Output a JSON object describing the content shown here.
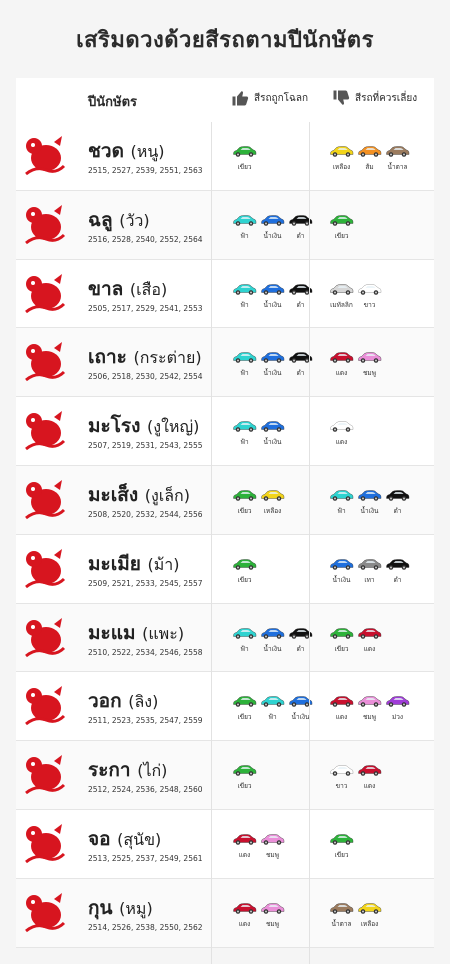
{
  "title": "เสริมดวงด้วยสีรถตามปีนักษัตร",
  "header": {
    "col_zodiac": "ปีนักษัตร",
    "col_good": "สีรถถูกโฉลก",
    "col_bad": "สีรถที่ควรเลี่ยง"
  },
  "icons": {
    "good": "thumbs-up-icon",
    "bad": "thumbs-down-icon"
  },
  "rows": [
    {
      "name": "ชวด",
      "sub": "(หนู)",
      "years": "2515, 2527, 2539, 2551, 2563",
      "good": [
        {
          "color": "#2db23a",
          "label": "เขียว"
        }
      ],
      "bad": [
        {
          "color": "#f2d41a",
          "label": "เหลือง"
        },
        {
          "color": "#f29022",
          "label": "ส้ม"
        },
        {
          "color": "#9b7b5e",
          "label": "น้ำตาล"
        }
      ]
    },
    {
      "name": "ฉลู",
      "sub": "(วัว)",
      "years": "2516, 2528, 2540, 2552, 2564",
      "good": [
        {
          "color": "#2ed3d0",
          "label": "ฟ้า"
        },
        {
          "color": "#1f6fdd",
          "label": "น้ำเงิน"
        },
        {
          "color": "#111111",
          "label": "ดำ"
        }
      ],
      "bad": [
        {
          "color": "#2db23a",
          "label": "เขียว"
        }
      ]
    },
    {
      "name": "ขาล",
      "sub": "(เสือ)",
      "years": "2505, 2517, 2529, 2541, 2553",
      "good": [
        {
          "color": "#2ed3d0",
          "label": "ฟ้า"
        },
        {
          "color": "#1f6fdd",
          "label": "น้ำเงิน"
        },
        {
          "color": "#111111",
          "label": "ดำ"
        }
      ],
      "bad": [
        {
          "color": "#d7d7d7",
          "label": "เมทัลลิก"
        },
        {
          "color": "#ffffff",
          "label": "ขาว"
        }
      ]
    },
    {
      "name": "เถาะ",
      "sub": "(กระต่าย)",
      "years": "2506, 2518, 2530, 2542, 2554",
      "good": [
        {
          "color": "#2ed3d0",
          "label": "ฟ้า"
        },
        {
          "color": "#1f6fdd",
          "label": "น้ำเงิน"
        },
        {
          "color": "#111111",
          "label": "ดำ"
        }
      ],
      "bad": [
        {
          "color": "#c8102e",
          "label": "แดง"
        },
        {
          "color": "#ea8fd8",
          "label": "ชมพู"
        }
      ]
    },
    {
      "name": "มะโรง",
      "sub": "(งูใหญ่)",
      "years": "2507, 2519, 2531, 2543, 2555",
      "good": [
        {
          "color": "#2ed3d0",
          "label": "ฟ้า"
        },
        {
          "color": "#1f6fdd",
          "label": "น้ำเงิน"
        }
      ],
      "bad": [
        {
          "color": "#ffffff",
          "label": "แดง"
        }
      ]
    },
    {
      "name": "มะเส็ง",
      "sub": "(งูเล็ก)",
      "years": "2508, 2520, 2532, 2544, 2556",
      "good": [
        {
          "color": "#2db23a",
          "label": "เขียว"
        },
        {
          "color": "#f2d41a",
          "label": "เหลือง"
        }
      ],
      "bad": [
        {
          "color": "#2ed3d0",
          "label": "ฟ้า"
        },
        {
          "color": "#1f6fdd",
          "label": "น้ำเงิน"
        },
        {
          "color": "#111111",
          "label": "ดำ"
        }
      ]
    },
    {
      "name": "มะเมีย",
      "sub": "(ม้า)",
      "years": "2509, 2521, 2533, 2545, 2557",
      "good": [
        {
          "color": "#2db23a",
          "label": "เขียว"
        }
      ],
      "bad": [
        {
          "color": "#1f6fdd",
          "label": "น้ำเงิน"
        },
        {
          "color": "#8a8a8a",
          "label": "เทา"
        },
        {
          "color": "#111111",
          "label": "ดำ"
        }
      ]
    },
    {
      "name": "มะแม",
      "sub": "(แพะ)",
      "years": "2510, 2522, 2534, 2546, 2558",
      "good": [
        {
          "color": "#2ed3d0",
          "label": "ฟ้า"
        },
        {
          "color": "#1f6fdd",
          "label": "น้ำเงิน"
        },
        {
          "color": "#111111",
          "label": "ดำ"
        }
      ],
      "bad": [
        {
          "color": "#2db23a",
          "label": "เขียว"
        },
        {
          "color": "#c8102e",
          "label": "แดง"
        }
      ]
    },
    {
      "name": "วอก",
      "sub": "(ลิง)",
      "years": "2511, 2523, 2535, 2547, 2559",
      "good": [
        {
          "color": "#2db23a",
          "label": "เขียว"
        },
        {
          "color": "#2ed3d0",
          "label": "ฟ้า"
        },
        {
          "color": "#1f6fdd",
          "label": "น้ำเงิน"
        }
      ],
      "bad": [
        {
          "color": "#c8102e",
          "label": "แดง"
        },
        {
          "color": "#ea8fd8",
          "label": "ชมพู"
        },
        {
          "color": "#a03cd8",
          "label": "ม่วง"
        }
      ]
    },
    {
      "name": "ระกา",
      "sub": "(ไก่)",
      "years": "2512, 2524, 2536, 2548, 2560",
      "good": [
        {
          "color": "#2db23a",
          "label": "เขียว"
        }
      ],
      "bad": [
        {
          "color": "#ffffff",
          "label": "ขาว"
        },
        {
          "color": "#c8102e",
          "label": "แดง"
        }
      ]
    },
    {
      "name": "จอ",
      "sub": "(สุนัข)",
      "years": "2513, 2525, 2537, 2549, 2561",
      "good": [
        {
          "color": "#c8102e",
          "label": "แดง"
        },
        {
          "color": "#ea8fd8",
          "label": "ชมพู"
        }
      ],
      "bad": [
        {
          "color": "#2db23a",
          "label": "เขียว"
        }
      ]
    },
    {
      "name": "กุน",
      "sub": "(หมู)",
      "years": "2514, 2526, 2538, 2550, 2562",
      "good": [
        {
          "color": "#c8102e",
          "label": "แดง"
        },
        {
          "color": "#ea8fd8",
          "label": "ชมพู"
        }
      ],
      "bad": [
        {
          "color": "#9b7b5e",
          "label": "น้ำตาล"
        },
        {
          "color": "#f2d41a",
          "label": "เหลือง"
        }
      ]
    }
  ],
  "animal_icons": [
    "rat-icon",
    "ox-icon",
    "tiger-icon",
    "rabbit-icon",
    "dragon-icon",
    "snake-icon",
    "horse-icon",
    "goat-icon",
    "monkey-icon",
    "rooster-icon",
    "dog-icon",
    "pig-icon"
  ],
  "accent_color": "#d7151f"
}
